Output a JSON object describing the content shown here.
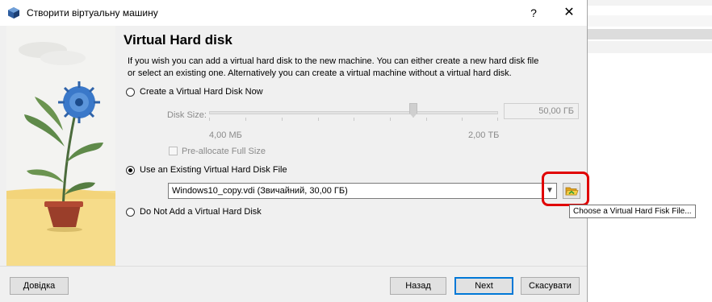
{
  "window": {
    "title": "Створити віртуальну машину",
    "help_glyph": "?",
    "close_glyph": "✕"
  },
  "page": {
    "heading": "Virtual Hard disk",
    "description": "If you wish you can add a virtual hard disk to the new machine. You can either create a new hard disk file or select an existing one. Alternatively you can create a virtual machine without a virtual hard disk."
  },
  "options": {
    "create_now": {
      "label": "Create a Virtual Hard Disk Now",
      "selected": false
    },
    "use_existing": {
      "label": "Use an Existing Virtual Hard Disk File",
      "selected": true
    },
    "no_disk": {
      "label": "Do Not Add a Virtual Hard Disk",
      "selected": false
    }
  },
  "disk_size": {
    "label": "Disk Size:",
    "value": "50,00 ГБ",
    "min_label": "4,00 МБ",
    "max_label": "2,00 ТБ",
    "slider_level": 0.71,
    "preallocate_label": "Pre-allocate Full Size",
    "preallocate_checked": false
  },
  "existing_file": {
    "selected": "Windows10_copy.vdi (Звичайний, 30,00 ГБ)",
    "tooltip": "Choose a Virtual Hard Fisk File..."
  },
  "footer": {
    "help": "Довідка",
    "back": "Назад",
    "next": "Next",
    "cancel": "Скасувати"
  },
  "colors": {
    "highlight": "#e00000",
    "dialog_bg": "#f0f0f0",
    "default_button_border": "#0078d7"
  },
  "icons": {
    "app": "virtualbox-icon",
    "folder": "folder-open-icon"
  }
}
